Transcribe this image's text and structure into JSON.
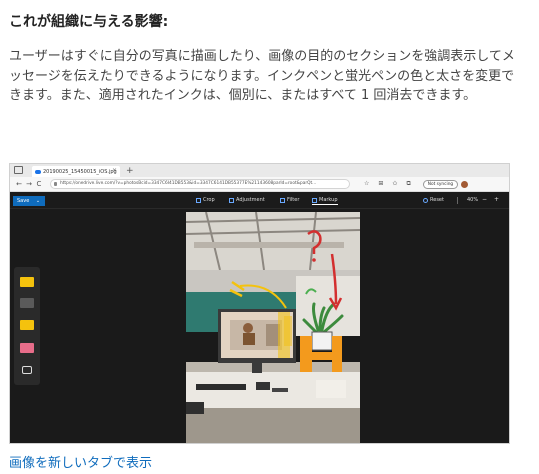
{
  "article": {
    "heading": "これが組織に与える影響:",
    "paragraph": "ユーザーはすぐに自分の写真に描画したり、画像の目的のセクションを強調表示してメッセージを伝えたりできるようになります。インクペンと蛍光ペンの色と太さを変更できます。また、適用されたインクは、個別に、またはすべて 1 回消去できます。",
    "link": "画像を新しいタブで表示"
  },
  "screenshot": {
    "browser": {
      "tab_title": "20190025_15450015_iOS.jpg",
      "tab_close": "×",
      "new_tab": "+",
      "url": "https://onedrive.live.com/?v=photosBcid=3347C6I41DB553&id=3347C6141DB55377E%21143608parId=root&parQt...",
      "sync_label": "Not syncing",
      "nav": {
        "back": "←",
        "forward": "→",
        "refresh": "C"
      },
      "addr_icons": [
        "☆",
        "⊞",
        "✩",
        "⧉"
      ]
    },
    "app_toolbar": {
      "save_label": "Save",
      "save_caret": "⌄",
      "tools": [
        {
          "label": "Crop",
          "icon": "crop-icon"
        },
        {
          "label": "Adjustment",
          "icon": "adjustment-icon"
        },
        {
          "label": "Filter",
          "icon": "filter-icon"
        },
        {
          "label": "Markup",
          "icon": "markup-icon",
          "active": true
        }
      ],
      "reset_label": "Reset",
      "zoom_value": "40%",
      "zoom_out": "−",
      "zoom_in": "+"
    },
    "pen_tray": {
      "pens": [
        {
          "name": "yellow-pen",
          "color": "#f4c20d"
        },
        {
          "name": "gray-pen",
          "color": "#6b6b6b"
        },
        {
          "name": "yellow-highlighter",
          "color": "#f4c20d"
        },
        {
          "name": "pink-highlighter",
          "color": "#e86d8a"
        },
        {
          "name": "eraser",
          "color": "#dddddd"
        }
      ]
    },
    "colors": {
      "accent": "#0f6cbd",
      "ink_red": "#d32f2f",
      "ink_yellow": "#f4c20d",
      "ink_orange": "#f39a1d",
      "ink_green": "#4caf50"
    }
  }
}
